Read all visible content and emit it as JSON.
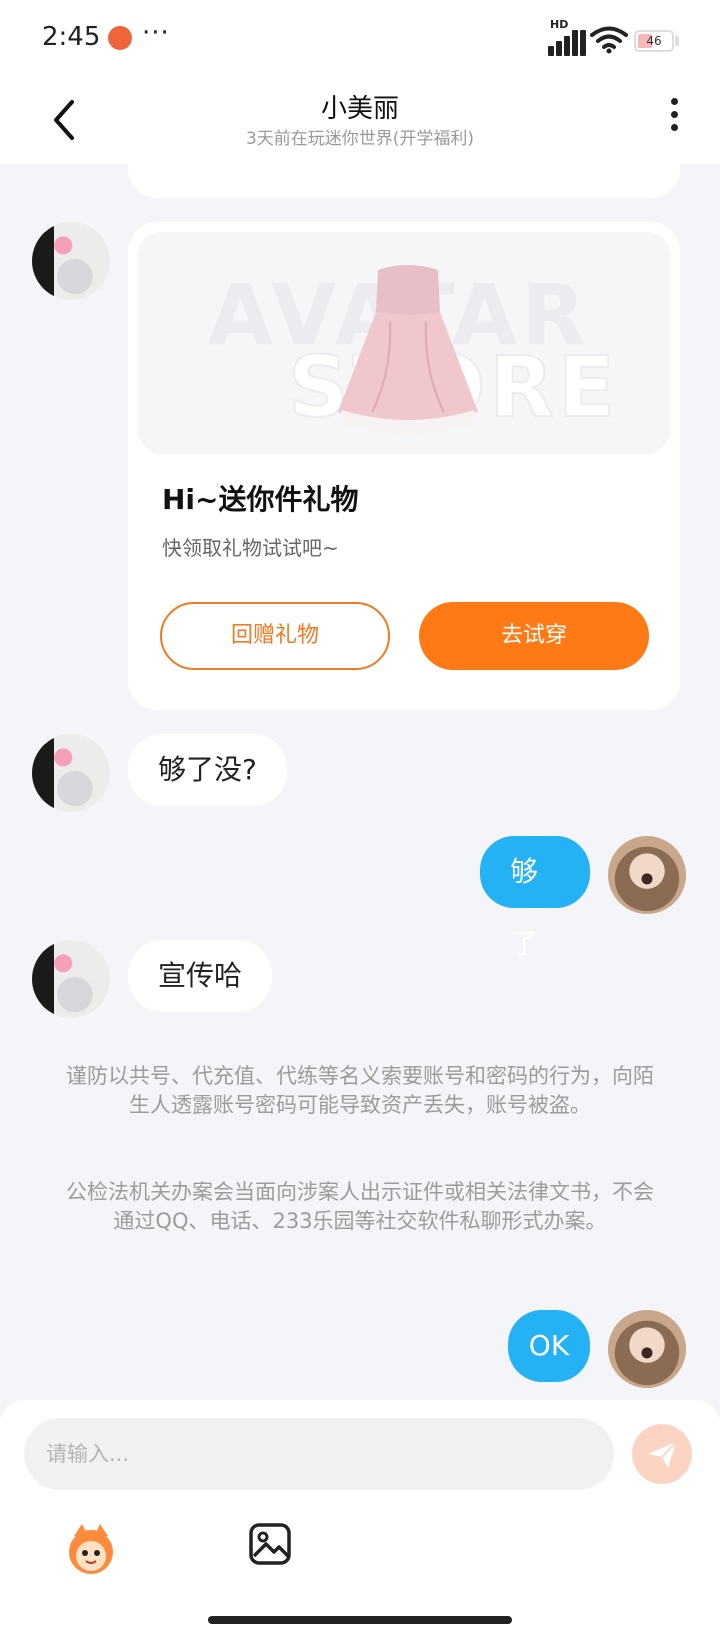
{
  "status_bar": {
    "time": "2:45",
    "more": "···",
    "network": "HD",
    "battery": "46"
  },
  "header": {
    "title": "小美丽",
    "subtitle": "3天前在玩迷你世界(开学福利)"
  },
  "gift_card": {
    "watermark_1": "AVATAR",
    "watermark_2": "STORE",
    "title": "Hi~送你件礼物",
    "description": "快领取礼物试试吧~",
    "return_gift_label": "回赠礼物",
    "try_on_label": "去试穿"
  },
  "messages": [
    {
      "side": "in",
      "text": "够了没?"
    },
    {
      "side": "out",
      "text": "够了"
    },
    {
      "side": "in",
      "text": "宣传哈"
    },
    {
      "side": "out",
      "text": "OK"
    }
  ],
  "notice": {
    "p1": "谨防以共号、代充值、代练等名义索要账号和密码的行为，向陌生人透露账号密码可能导致资产丢失，账号被盗。",
    "p2": "公检法机关办案会当面向涉案人出示证件或相关法律文书，不会通过QQ、电话、233乐园等社交软件私聊形式办案。"
  },
  "input": {
    "placeholder": "请输入..."
  },
  "colors": {
    "accent": "#ff7a14",
    "out_bubble": "#25b2f5",
    "background": "#f4f5f8"
  },
  "icons": [
    "back-arrow-icon",
    "more-vert-icon",
    "send-icon",
    "emoji-mascot-icon",
    "image-icon"
  ]
}
